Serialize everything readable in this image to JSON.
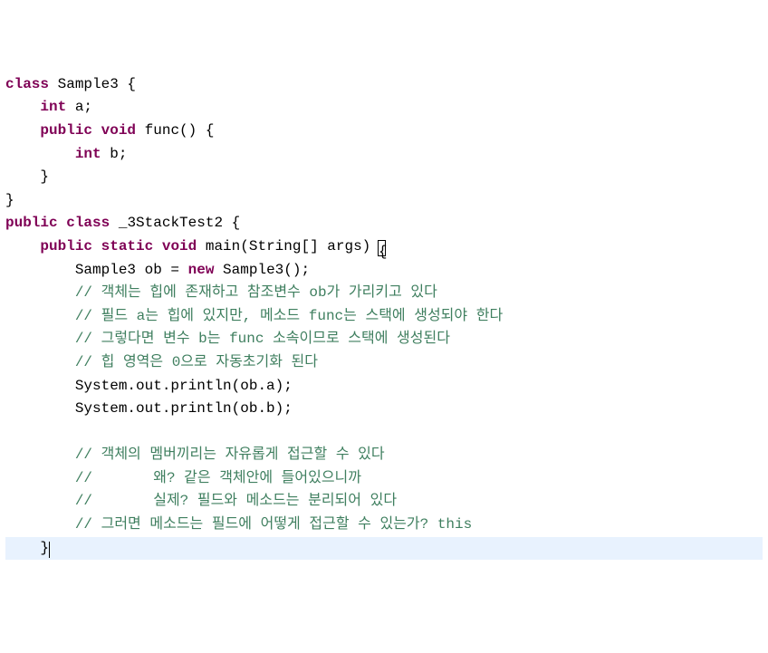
{
  "code": {
    "l1": {
      "kw1": "class",
      "t1": " Sample3 {"
    },
    "l2": {
      "indent": "    ",
      "kw1": "int",
      "t1": " a;"
    },
    "l3": {
      "indent": "    ",
      "kw1": "public",
      "space": " ",
      "kw2": "void",
      "t1": " func() {"
    },
    "l4": {
      "indent": "        ",
      "kw1": "int",
      "t1": " b;"
    },
    "l5": {
      "indent": "    ",
      "t1": "}"
    },
    "l6": {
      "t1": "}"
    },
    "l7": {
      "kw1": "public",
      "s1": " ",
      "kw2": "class",
      "t1": " _3StackTest2 {"
    },
    "l8": {
      "indent": "    ",
      "kw1": "public",
      "s1": " ",
      "kw2": "static",
      "s2": " ",
      "kw3": "void",
      "t1": " main(String[] args) "
    },
    "l9": {
      "indent": "        ",
      "t1": "Sample3 ob = ",
      "kw1": "new",
      "t2": " Sample3();"
    },
    "l10": {
      "indent": "        ",
      "cm": "// 객체는 힙에 존재하고 참조변수 ob가 가리키고 있다"
    },
    "l11": {
      "indent": "        ",
      "cm": "// 필드 a는 힙에 있지만, 메소드 func는 스택에 생성되야 한다"
    },
    "l12": {
      "indent": "        ",
      "cm": "// 그렇다면 변수 b는 func 소속이므로 스택에 생성된다"
    },
    "l13": {
      "indent": "        ",
      "cm": "// 힙 영역은 0으로 자동초기화 된다"
    },
    "l14": {
      "indent": "        ",
      "t1": "System.out.println(ob.a);"
    },
    "l15": {
      "indent": "        ",
      "t1": "System.out.println(ob.b);"
    },
    "l16": {
      "empty": ""
    },
    "l17": {
      "indent": "        ",
      "cm": "// 객체의 멤버끼리는 자유롭게 접근할 수 있다"
    },
    "l18": {
      "indent": "        ",
      "cm": "//       왜? 같은 객체안에 들어있으니까"
    },
    "l19": {
      "indent": "        ",
      "cm": "//       실제? 필드와 메소드는 분리되어 있다"
    },
    "l20": {
      "indent": "        ",
      "cm": "// 그러면 메소드는 필드에 어떻게 접근할 수 있는가? this"
    },
    "l21": {
      "indent": "    ",
      "t1": "}"
    }
  }
}
